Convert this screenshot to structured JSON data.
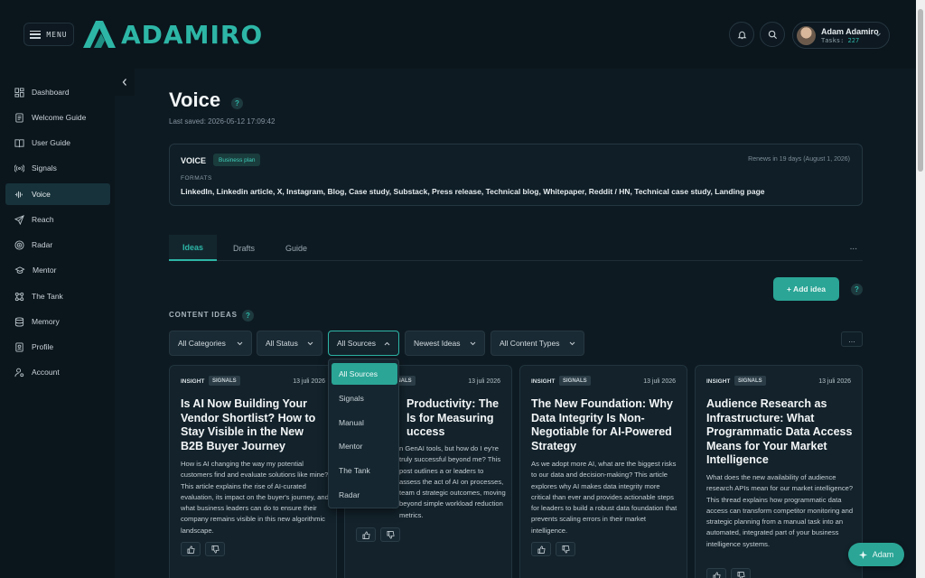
{
  "header": {
    "menu_label": "MENU",
    "logo_text": "ADAMIRO",
    "user_name": "Adam Adamiro",
    "tasks_label": "Tasks:",
    "tasks_count": "227"
  },
  "sidebar": {
    "items": [
      {
        "label": "Dashboard",
        "icon": "dashboard-icon"
      },
      {
        "label": "Welcome Guide",
        "icon": "document-icon"
      },
      {
        "label": "User Guide",
        "icon": "book-icon"
      },
      {
        "label": "Signals",
        "icon": "signal-icon"
      },
      {
        "label": "Voice",
        "icon": "waveform-icon",
        "active": true
      },
      {
        "label": "Reach",
        "icon": "send-icon"
      },
      {
        "label": "Radar",
        "icon": "radar-icon"
      },
      {
        "label": "Mentor",
        "icon": "graduation-cap-icon"
      },
      {
        "label": "The Tank",
        "icon": "network-icon"
      },
      {
        "label": "Memory",
        "icon": "database-icon"
      },
      {
        "label": "Profile",
        "icon": "profile-card-icon"
      },
      {
        "label": "Account",
        "icon": "user-gear-icon"
      }
    ]
  },
  "page": {
    "title": "Voice",
    "help": "?",
    "last_saved": "Last saved: 2026-05-12 17:09:42"
  },
  "voice_card": {
    "title": "VOICE",
    "badge": "Business plan",
    "renews": "Renews in 19 days (August 1, 2026)",
    "formats_label": "FORMATS",
    "formats": "LinkedIn, Linkedin article, X, Instagram, Blog, Case study, Substack, Press release, Technical blog, Whitepaper, Reddit / HN, Technical case study, Landing page"
  },
  "tabs": [
    {
      "label": "Ideas",
      "active": true
    },
    {
      "label": "Drafts"
    },
    {
      "label": "Guide"
    }
  ],
  "tabs_more": "...",
  "add_idea_label": "+ Add idea",
  "content_ideas_label": "CONTENT IDEAS",
  "filters": {
    "categories": "All Categories",
    "status": "All Status",
    "sources": "All Sources",
    "sort": "Newest Ideas",
    "content_types": "All Content Types"
  },
  "more_label": "...",
  "sources_dropdown": {
    "options": [
      "All Sources",
      "Signals",
      "Manual",
      "Mentor",
      "The Tank",
      "Radar"
    ],
    "selected": "All Sources"
  },
  "cards": [
    {
      "kind": "INSIGHT",
      "tag": "SIGNALS",
      "date": "13 juli 2026",
      "title": "Is AI Now Building Your Vendor Shortlist? How to Stay Visible in the New B2B Buyer Journey",
      "body": "How is AI changing the way my potential customers find and evaluate solutions like mine? This article explains the rise of AI-curated evaluation, its impact on the buyer's journey, and what business leaders can do to ensure their company remains visible in this new algorithmic landscape."
    },
    {
      "kind": "INSIGHT",
      "tag": "SIGNALS",
      "date": "13 juli 2026",
      "title": "Productivity: The ls for Measuring uccess",
      "body": "n GenAI tools, but how do I ey're truly successful beyond me? This post outlines a or leaders to assess the act of AI on processes, team d strategic outcomes, moving beyond simple workload reduction metrics."
    },
    {
      "kind": "INSIGHT",
      "tag": "SIGNALS",
      "date": "13 juli 2026",
      "title": "The New Foundation: Why Data Integrity Is Non-Negotiable for AI-Powered Strategy",
      "body": "As we adopt more AI, what are the biggest risks to our data and decision-making? This article explores why AI makes data integrity more critical than ever and provides actionable steps for leaders to build a robust data foundation that prevents scaling errors in their market intelligence."
    },
    {
      "kind": "INSIGHT",
      "tag": "SIGNALS",
      "date": "13 juli 2026",
      "title": "Audience Research as Infrastructure: What Programmatic Data Access Means for Your Market Intelligence",
      "body": "What does the new availability of audience research APIs mean for our market intelligence? This thread explains how programmatic data access can transform competitor monitoring and strategic planning from a manual task into an automated, integrated part of your business intelligence systems."
    }
  ],
  "assistant_button": "Adam",
  "colors": {
    "accent": "#2aa596",
    "background": "#0e1a22",
    "sidebar": "#0b151c",
    "card": "#13222b"
  }
}
